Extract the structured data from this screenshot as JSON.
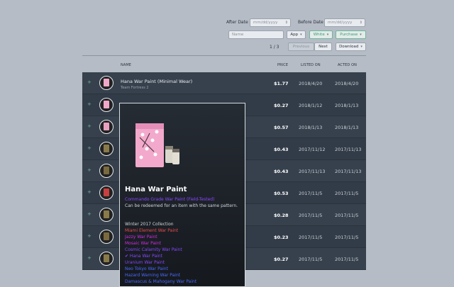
{
  "filters": {
    "after_date_label": "After Date",
    "after_date_placeholder": "mm/dd/yyyy",
    "before_date_label": "Before Date",
    "before_date_placeholder": "mm/dd/yyyy",
    "name_placeholder": "Name",
    "app_label": "App",
    "white_label": "White",
    "purchase_label": "Purchase"
  },
  "pagination": {
    "info": "1 / 3",
    "previous": "Previous",
    "next": "Next",
    "download": "Download"
  },
  "table": {
    "headers": {
      "name": "NAME",
      "price": "PRICE",
      "listed": "LISTED ON",
      "acted": "ACTED ON"
    },
    "rows": [
      {
        "name": "Hana War Paint (Minimal Wear)",
        "game": "Team Fortress 2",
        "price": "$1.77",
        "listed": "2018/4/20",
        "acted": "2018/4/20",
        "thumb": "#f0a8c8"
      },
      {
        "name": "",
        "game": "",
        "price": "$0.27",
        "listed": "2018/1/12",
        "acted": "2018/1/13",
        "thumb": "#f0a8c8"
      },
      {
        "name": "",
        "game": "",
        "price": "$0.57",
        "listed": "2018/1/13",
        "acted": "2018/1/13",
        "thumb": "#e8a0c0"
      },
      {
        "name": "",
        "game": "",
        "price": "$0.43",
        "listed": "2017/11/12",
        "acted": "2017/11/13",
        "thumb": "#8a7a4a"
      },
      {
        "name": "",
        "game": "",
        "price": "$0.43",
        "listed": "2017/11/13",
        "acted": "2017/11/13",
        "thumb": "#7a6a40"
      },
      {
        "name": "",
        "game": "",
        "price": "$0.53",
        "listed": "2017/11/5",
        "acted": "2017/11/5",
        "thumb": "#c84040"
      },
      {
        "name": "",
        "game": "",
        "price": "$0.28",
        "listed": "2017/11/5",
        "acted": "2017/11/5",
        "thumb": "#8a7a4a"
      },
      {
        "name": "",
        "game": "",
        "price": "$0.23",
        "listed": "2017/11/5",
        "acted": "2017/11/5",
        "thumb": "#7a6a40"
      },
      {
        "name": "",
        "game": "",
        "price": "$0.27",
        "listed": "2017/11/5",
        "acted": "2017/11/5",
        "thumb": "#8a7a4a"
      }
    ]
  },
  "tooltip": {
    "title": "Hana War Paint",
    "grade": "Commando Grade War Paint (Field-Tested)",
    "desc": "Can be redeemed for an item with the same pattern.",
    "collection_title": "Winter 2017 Collection",
    "items": [
      {
        "text": "Miami Element War Paint",
        "color": "#eb4b4b"
      },
      {
        "text": "Jazzy War Paint",
        "color": "#d32ce6"
      },
      {
        "text": "Mosaic War Paint",
        "color": "#d32ce6"
      },
      {
        "text": "Cosmic Calamity War Paint",
        "color": "#8847ff"
      },
      {
        "text": "✔ Hana War Paint",
        "color": "#8847ff"
      },
      {
        "text": "Uranium War Paint",
        "color": "#8847ff"
      },
      {
        "text": "Neo Tokyo War Paint",
        "color": "#4b69ff"
      },
      {
        "text": "Hazard Warning War Paint",
        "color": "#4b69ff"
      },
      {
        "text": "Damascus & Mahogany War Paint",
        "color": "#4b69ff"
      }
    ]
  }
}
